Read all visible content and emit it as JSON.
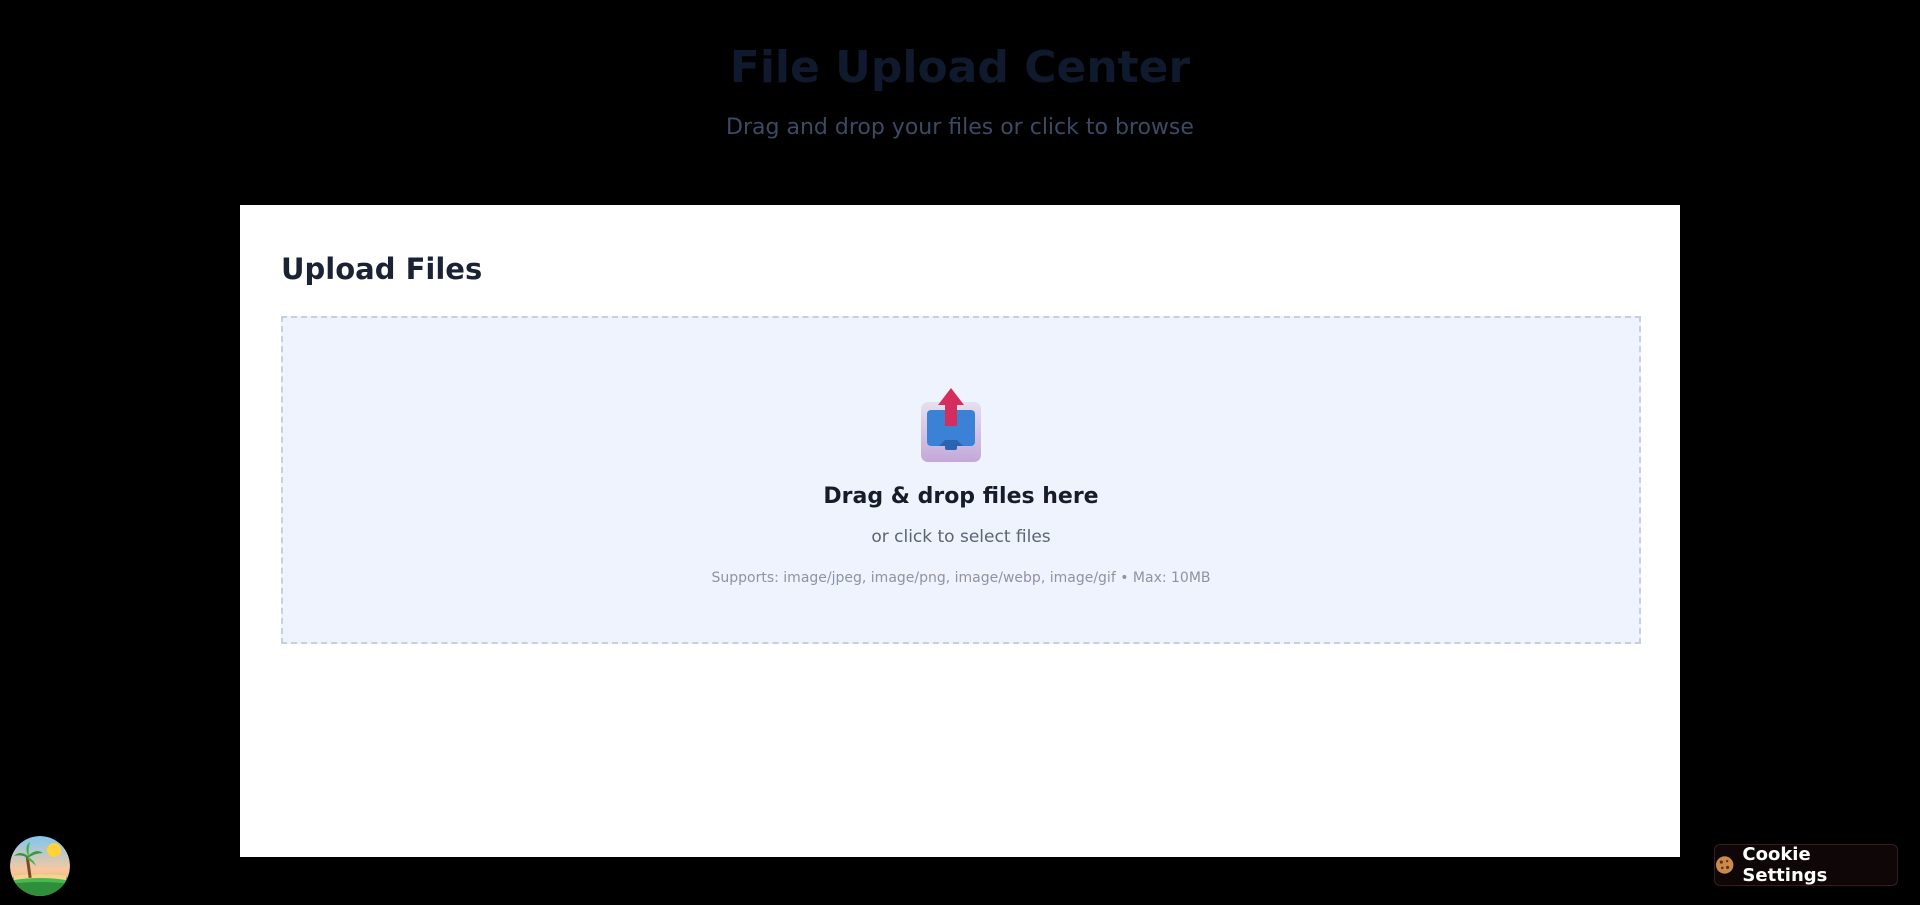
{
  "header": {
    "title": "File Upload Center",
    "subtitle": "Drag and drop your files or click to browse"
  },
  "upload_card": {
    "title": "Upload Files",
    "dropzone": {
      "icon": "upload-tray-icon",
      "title": "Drag & drop files here",
      "subtitle": "or click to select files",
      "hint": "Supports: image/jpeg, image/png, image/webp, image/gif • Max: 10MB"
    }
  },
  "footer": {
    "avatar_icon": "beach-palm-avatar-icon",
    "cookie_button": {
      "icon": "cookie-icon",
      "label": "Cookie Settings"
    }
  },
  "colors": {
    "page_background": "#000000",
    "card_background": "#ffffff",
    "dropzone_background": "#eef3fd",
    "dropzone_border": "#c7cfe0",
    "arrow_accent": "#d62d5f",
    "tray_blue": "#3b82d6"
  }
}
